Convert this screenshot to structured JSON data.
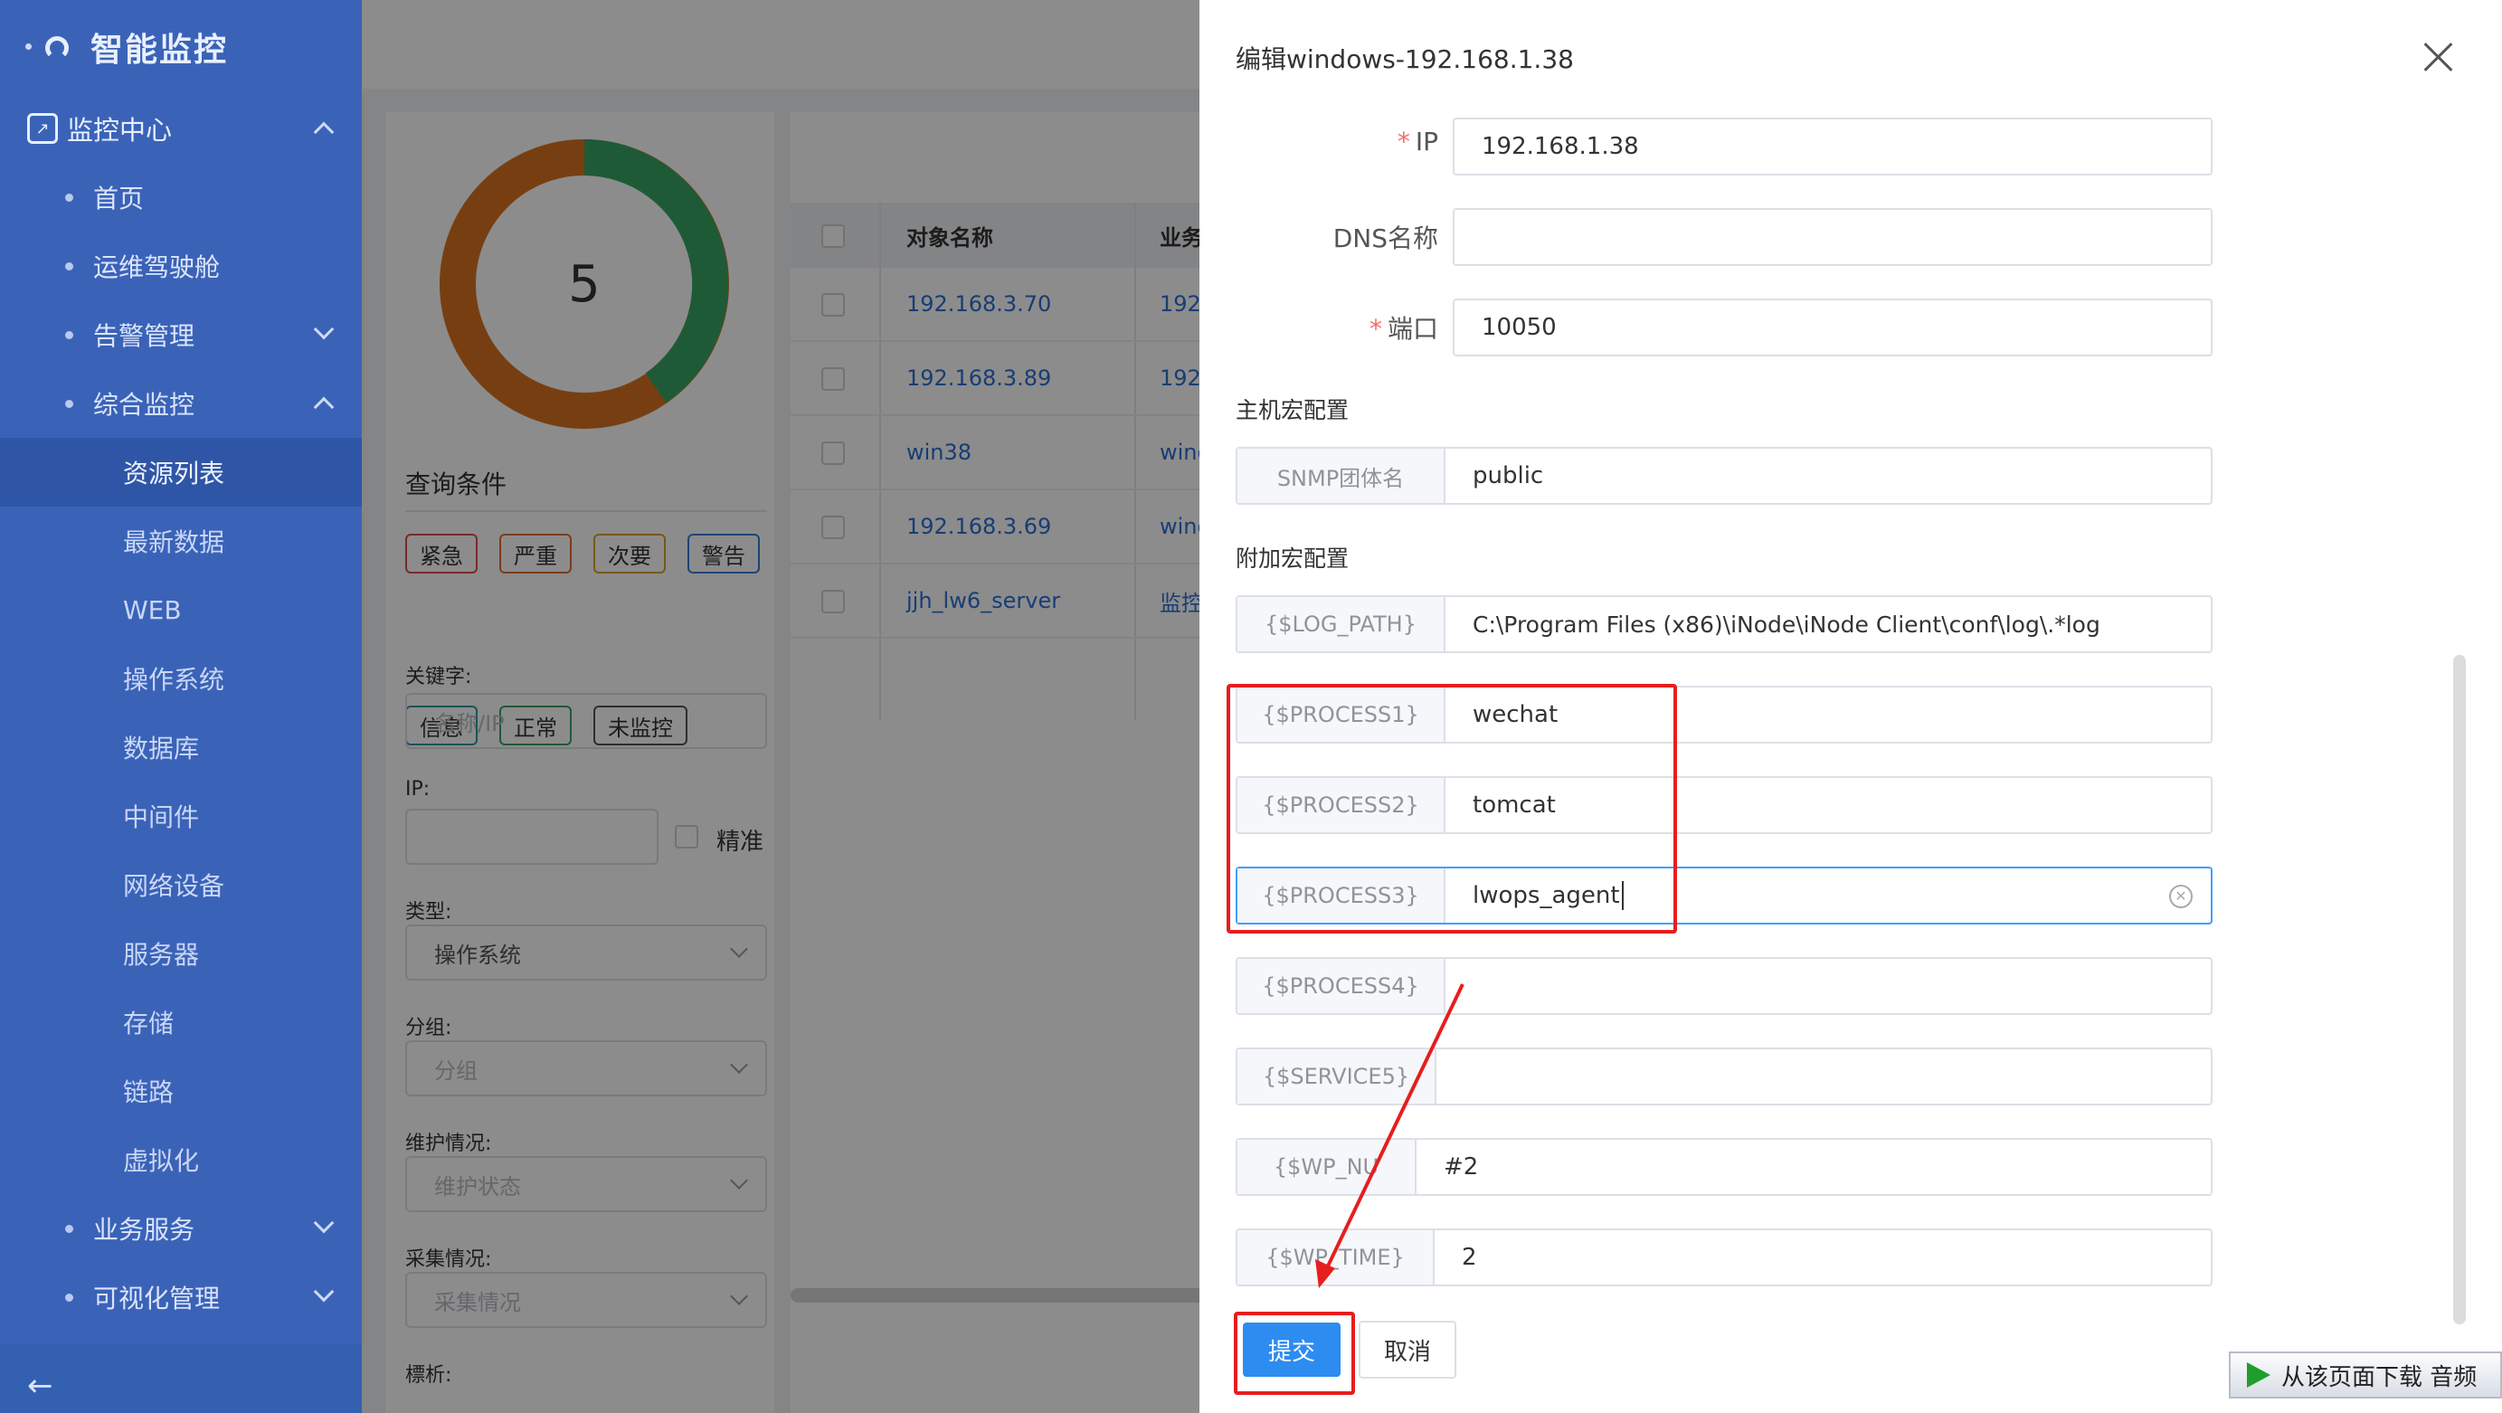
{
  "app": {
    "name": "智能监控"
  },
  "sidebar": {
    "group_monitor": "监控中心",
    "items": {
      "home": "首页",
      "ops_cockpit": "运维驾驶舱",
      "alarm_mgmt": "告警管理",
      "integrated": "综合监控",
      "business": "业务服务",
      "visual": "可视化管理"
    },
    "subitems": [
      "资源列表",
      "最新数据",
      "WEB",
      "操作系统",
      "数据库",
      "中间件",
      "网络设备",
      "服务器",
      "存储",
      "链路",
      "虚拟化"
    ],
    "collapse_icon": "←"
  },
  "summary": {
    "total": "5",
    "colors": {
      "green": "#3aa463",
      "orange": "#d9731f"
    }
  },
  "filters": {
    "title": "查询条件",
    "tags": [
      {
        "label": "紧急",
        "color": "#e24c4c"
      },
      {
        "label": "严重",
        "color": "#e0702e"
      },
      {
        "label": "次要",
        "color": "#d7a51f"
      },
      {
        "label": "警告",
        "color": "#3c7bd6"
      },
      {
        "label": "信息",
        "color": "#2c9aa3"
      },
      {
        "label": "正常",
        "color": "#3aa463"
      },
      {
        "label": "未监控",
        "color": "#555555"
      }
    ],
    "keyword_label": "关键字:",
    "keyword_placeholder": "名称/IP",
    "ip_label": "IP:",
    "exact_label": "精准",
    "type_label": "类型:",
    "type_value": "操作系统",
    "group_label": "分组:",
    "group_placeholder": "分组",
    "maint_label": "维护情况:",
    "maint_placeholder": "维护状态",
    "collect_label": "采集情况:",
    "collect_placeholder": "采集情况",
    "tag_label": "標析:"
  },
  "table": {
    "headers": [
      "对象名称",
      "业务"
    ],
    "rows": [
      {
        "name": "192.168.3.70",
        "biz": "192."
      },
      {
        "name": "192.168.3.89",
        "biz": "192."
      },
      {
        "name": "win38",
        "biz": "wind"
      },
      {
        "name": "192.168.3.69",
        "biz": "wind"
      },
      {
        "name": "jjh_lw6_server",
        "biz": "监控"
      }
    ]
  },
  "drawer": {
    "title": "编辑windows-192.168.1.38",
    "fields": {
      "ip_label": "IP",
      "ip_value": "192.168.1.38",
      "dns_label": "DNS名称",
      "dns_value": "",
      "port_label": "端口",
      "port_value": "10050"
    },
    "host_macro_title": "主机宏配置",
    "host_macros": [
      {
        "key": "SNMP团体名",
        "value": "public"
      }
    ],
    "extra_macro_title": "附加宏配置",
    "extra_macros": [
      {
        "key": "{$LOG_PATH}",
        "value": "C:\\Program Files (x86)\\iNode\\iNode Client\\conf\\log\\.*log"
      },
      {
        "key": "{$PROCESS1}",
        "value": "wechat"
      },
      {
        "key": "{$PROCESS2}",
        "value": "tomcat"
      },
      {
        "key": "{$PROCESS3}",
        "value": "lwops_agent"
      },
      {
        "key": "{$PROCESS4}",
        "value": ""
      },
      {
        "key": "{$SERVICE5}",
        "value": ""
      },
      {
        "key": "{$WP_NU",
        "value": "#2"
      },
      {
        "key": "{$WP_TIME}",
        "value": "2"
      }
    ],
    "submit_label": "提交",
    "cancel_label": "取消"
  },
  "annotation": {
    "color": "#e61e1e"
  },
  "download_banner": {
    "text": "从该页面下载 音频"
  }
}
